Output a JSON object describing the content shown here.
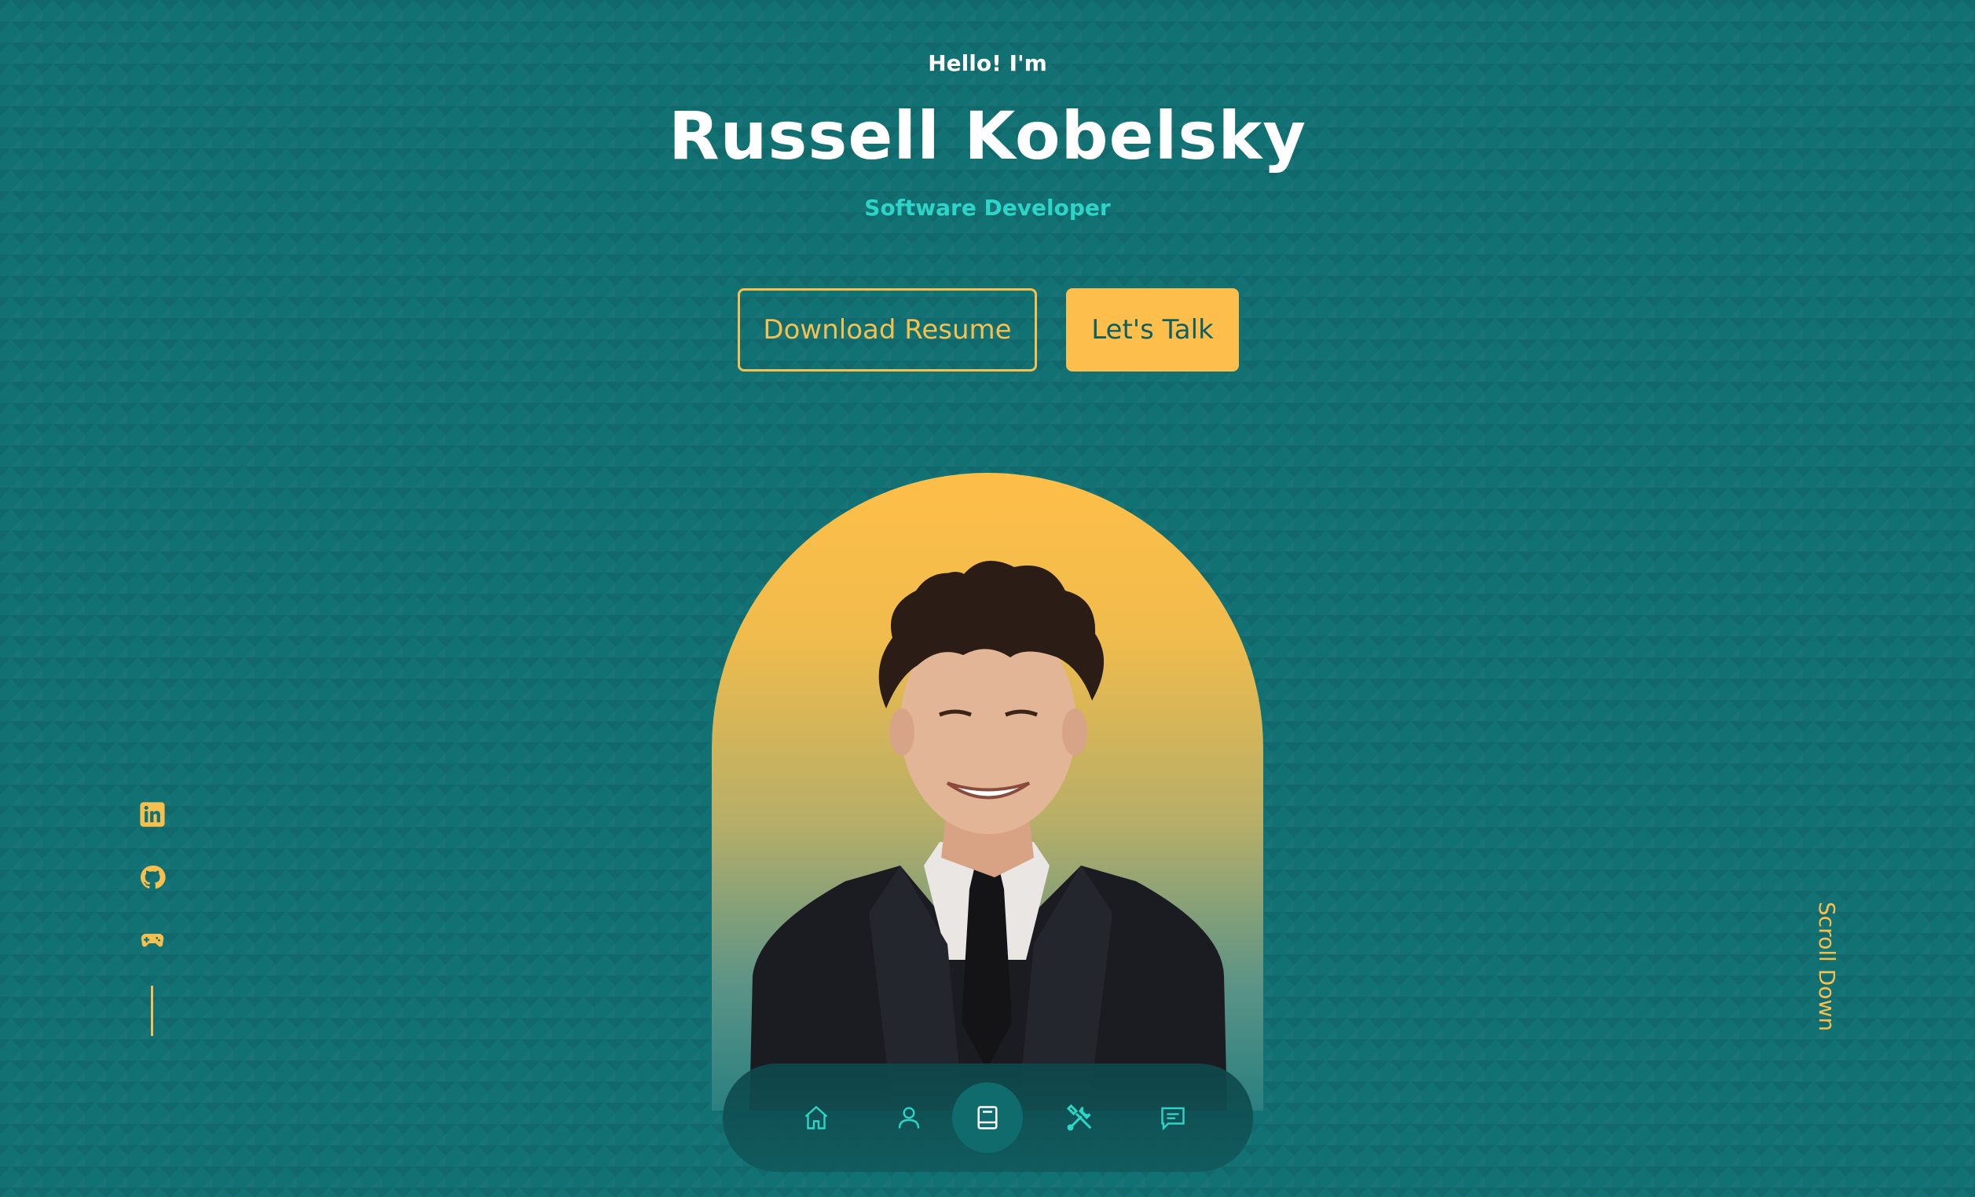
{
  "hero": {
    "greeting": "Hello! I'm",
    "name": "Russell Kobelsky",
    "role": "Software Developer"
  },
  "buttons": {
    "download_resume": "Download Resume",
    "lets_talk": "Let's Talk"
  },
  "social": [
    {
      "icon": "linkedin-icon"
    },
    {
      "icon": "github-icon"
    },
    {
      "icon": "gamepad-icon"
    }
  ],
  "scroll": {
    "label": "Scroll Down"
  },
  "nav": {
    "items": [
      {
        "icon": "home-icon"
      },
      {
        "icon": "user-icon"
      },
      {
        "icon": "book-icon",
        "active": true
      },
      {
        "icon": "tools-icon"
      },
      {
        "icon": "message-icon"
      }
    ]
  },
  "colors": {
    "background": "#127173",
    "accent": "#fdbe4c",
    "role_text": "#2dd4c8",
    "nav_icon": "#2dd4c8"
  }
}
